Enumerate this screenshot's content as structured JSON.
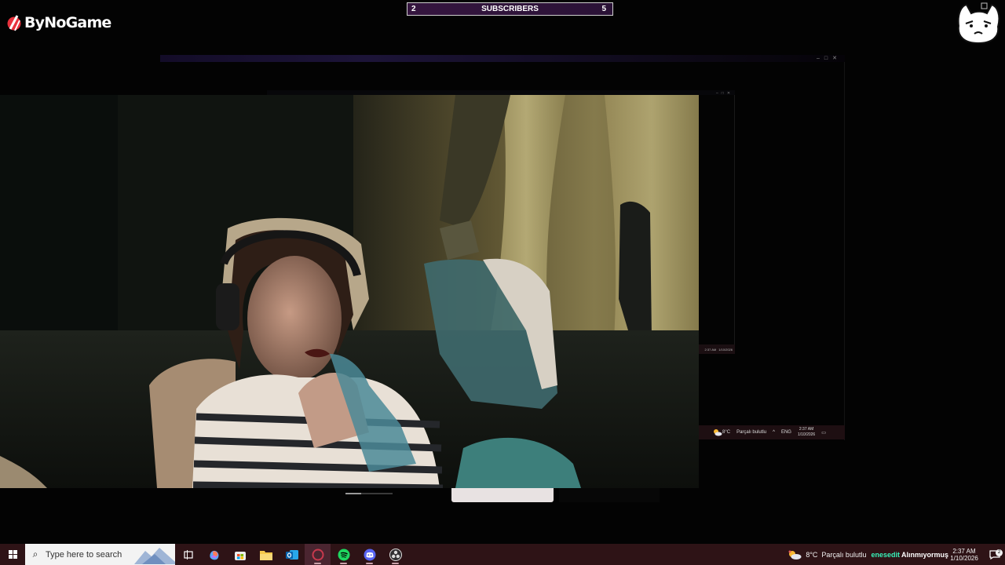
{
  "overlay": {
    "brand": "ByNoGame",
    "subscribers": {
      "label": "SUBSCRIBERS",
      "current": "2",
      "goal": "5",
      "progress": 0.4,
      "bar_color": "#35153f"
    },
    "mascot_icon": "cat-face-icon"
  },
  "captured_window": {
    "controls": [
      "–",
      "□",
      "✕"
    ],
    "inner_tray": {
      "time": "2:37 AM",
      "date": "1/10/2026"
    },
    "tray": {
      "temperature": "8°C",
      "weather": "Parçalı bulutlu",
      "language": "ENG",
      "time": "2:37 AM",
      "date": "1/10/2026"
    }
  },
  "webcam": {
    "description_icon": "webcam-feed"
  },
  "taskbar": {
    "search_placeholder": "Type here to search",
    "apps": [
      {
        "name": "task-view-icon",
        "running": false
      },
      {
        "name": "copilot-icon",
        "running": false
      },
      {
        "name": "store-icon",
        "running": false
      },
      {
        "name": "file-explorer-icon",
        "running": false
      },
      {
        "name": "outlook-icon",
        "running": false
      },
      {
        "name": "app-icon",
        "running": true,
        "active": true
      },
      {
        "name": "spotify-icon",
        "running": true
      },
      {
        "name": "discord-icon",
        "running": true
      },
      {
        "name": "obs-icon",
        "running": true
      }
    ],
    "temperature": "8°C",
    "weather": "Parçalı bulutlu",
    "overlay_user": "enesedit",
    "overlay_message": "Alınmıyormuş",
    "time": "2:37 AM",
    "date": "1/10/2026",
    "notification_count": "2",
    "accent": "#2e1316"
  }
}
